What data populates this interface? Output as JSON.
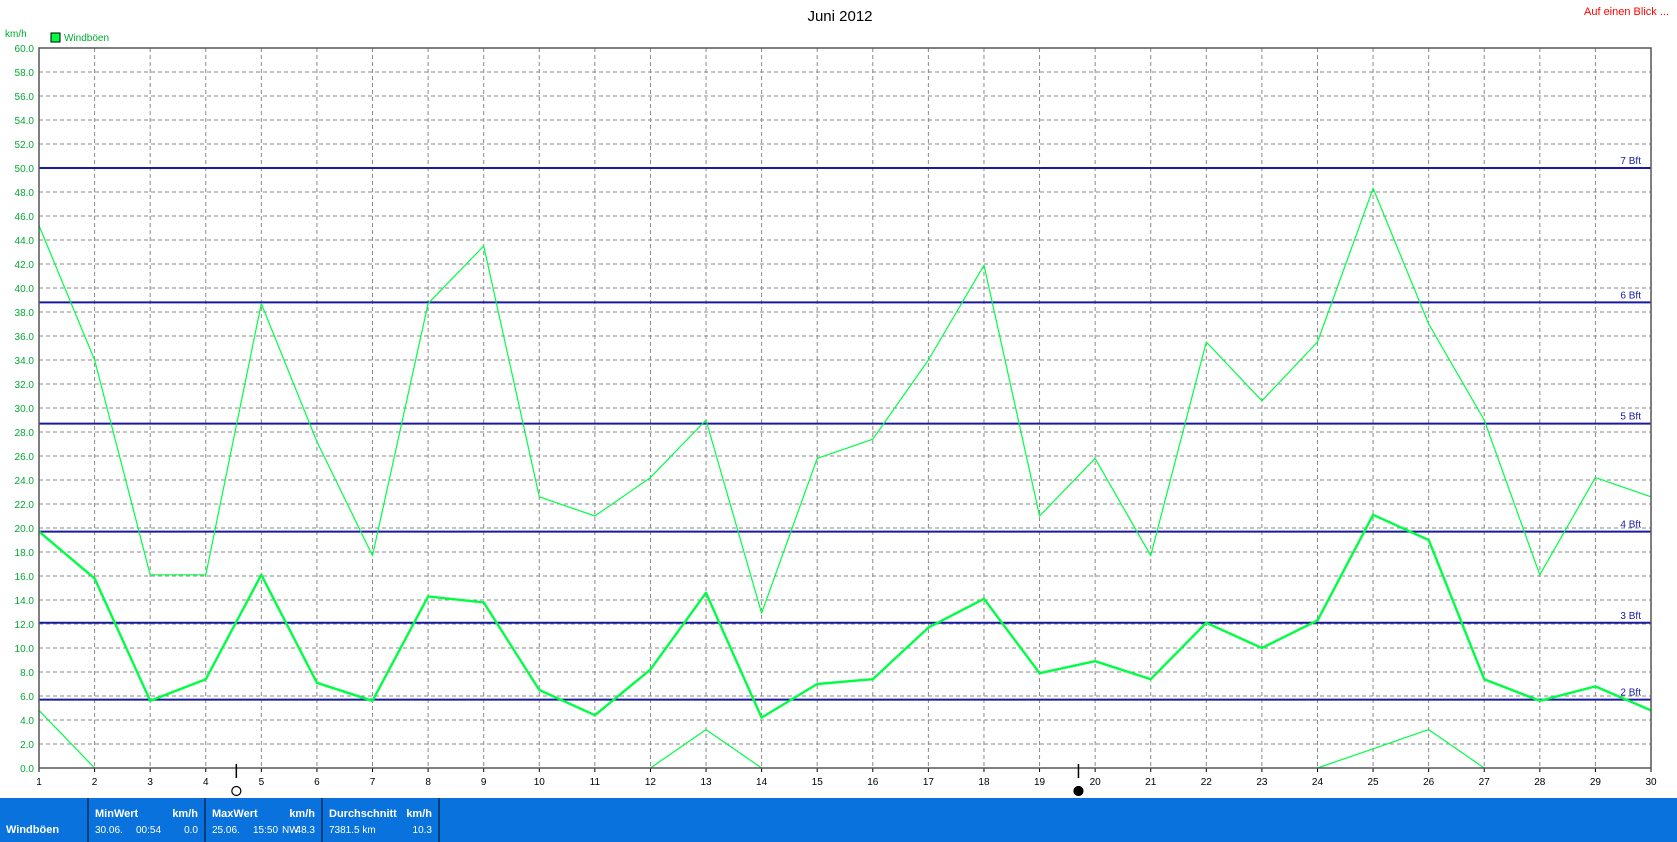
{
  "header": {
    "link_label": "Auf einen Blick ..."
  },
  "colors": {
    "series": "#00ff44",
    "beaufort_line": "#1a1aa0",
    "beaufort_label": "#1a1aa0",
    "footer_bg": "#0a72dc"
  },
  "chart_data": {
    "type": "line",
    "title": "Juni 2012",
    "ylabel": "km/h",
    "ylim": [
      0,
      60
    ],
    "yticks": [
      "0.0",
      "2.0",
      "4.0",
      "6.0",
      "8.0",
      "10.0",
      "12.0",
      "14.0",
      "16.0",
      "18.0",
      "20.0",
      "22.0",
      "24.0",
      "26.0",
      "28.0",
      "30.0",
      "32.0",
      "34.0",
      "36.0",
      "38.0",
      "40.0",
      "42.0",
      "44.0",
      "46.0",
      "48.0",
      "50.0",
      "52.0",
      "54.0",
      "56.0",
      "58.0",
      "60.0"
    ],
    "x": [
      1,
      2,
      3,
      4,
      5,
      6,
      7,
      8,
      9,
      10,
      11,
      12,
      13,
      14,
      15,
      16,
      17,
      18,
      19,
      20,
      21,
      22,
      23,
      24,
      25,
      26,
      27,
      28,
      29,
      30
    ],
    "grid": true,
    "legend": {
      "position": "top-left",
      "entries": [
        "Windböen"
      ]
    },
    "series": [
      {
        "name": "Windböen",
        "role": "max",
        "values": [
          45.2,
          34.0,
          16.1,
          16.1,
          38.7,
          27.2,
          17.7,
          38.7,
          43.5,
          22.6,
          21.0,
          24.2,
          29.0,
          12.9,
          25.8,
          27.4,
          34.0,
          41.9,
          21.0,
          25.8,
          17.7,
          35.5,
          30.6,
          35.5,
          48.3,
          37.0,
          29.0,
          16.1,
          24.2,
          22.6
        ]
      },
      {
        "name": "Windböen",
        "role": "avg",
        "values": [
          19.7,
          15.8,
          5.6,
          7.4,
          16.1,
          7.1,
          5.6,
          14.3,
          13.8,
          6.5,
          4.4,
          8.2,
          14.6,
          4.2,
          7.0,
          7.4,
          11.7,
          14.1,
          7.9,
          8.9,
          7.4,
          12.1,
          10.0,
          12.3,
          21.1,
          19.0,
          7.4,
          5.6,
          6.8,
          4.8
        ]
      },
      {
        "name": "Windböen",
        "role": "min",
        "values": [
          4.8,
          0.0,
          null,
          null,
          null,
          null,
          null,
          null,
          null,
          null,
          null,
          0.0,
          3.2,
          0.0,
          null,
          null,
          null,
          null,
          null,
          null,
          null,
          null,
          null,
          0.0,
          1.6,
          3.2,
          0.0,
          null,
          null,
          null
        ]
      }
    ],
    "reference_lines": [
      {
        "label": "7 Bft",
        "value": 50.0
      },
      {
        "label": "6 Bft",
        "value": 38.8
      },
      {
        "label": "5 Bft",
        "value": 28.7
      },
      {
        "label": "4 Bft",
        "value": 19.7
      },
      {
        "label": "3 Bft",
        "value": 12.1
      },
      {
        "label": "2 Bft",
        "value": 5.7
      }
    ],
    "moon_phases": [
      {
        "day": 4.55,
        "phase": "new"
      },
      {
        "day": 19.7,
        "phase": "full"
      }
    ]
  },
  "footer": {
    "row_label": "Windböen",
    "min": {
      "header": "MinWert",
      "unit": "km/h",
      "date": "30.06.",
      "time": "00:54",
      "value": "0.0"
    },
    "max": {
      "header": "MaxWert",
      "unit": "km/h",
      "date": "25.06.",
      "time": "15:50",
      "dir": "NW",
      "value": "48.3"
    },
    "avg": {
      "header": "Durchschnitt",
      "unit": "km/h",
      "distance": "7381.5 km",
      "value": "10.3"
    }
  }
}
